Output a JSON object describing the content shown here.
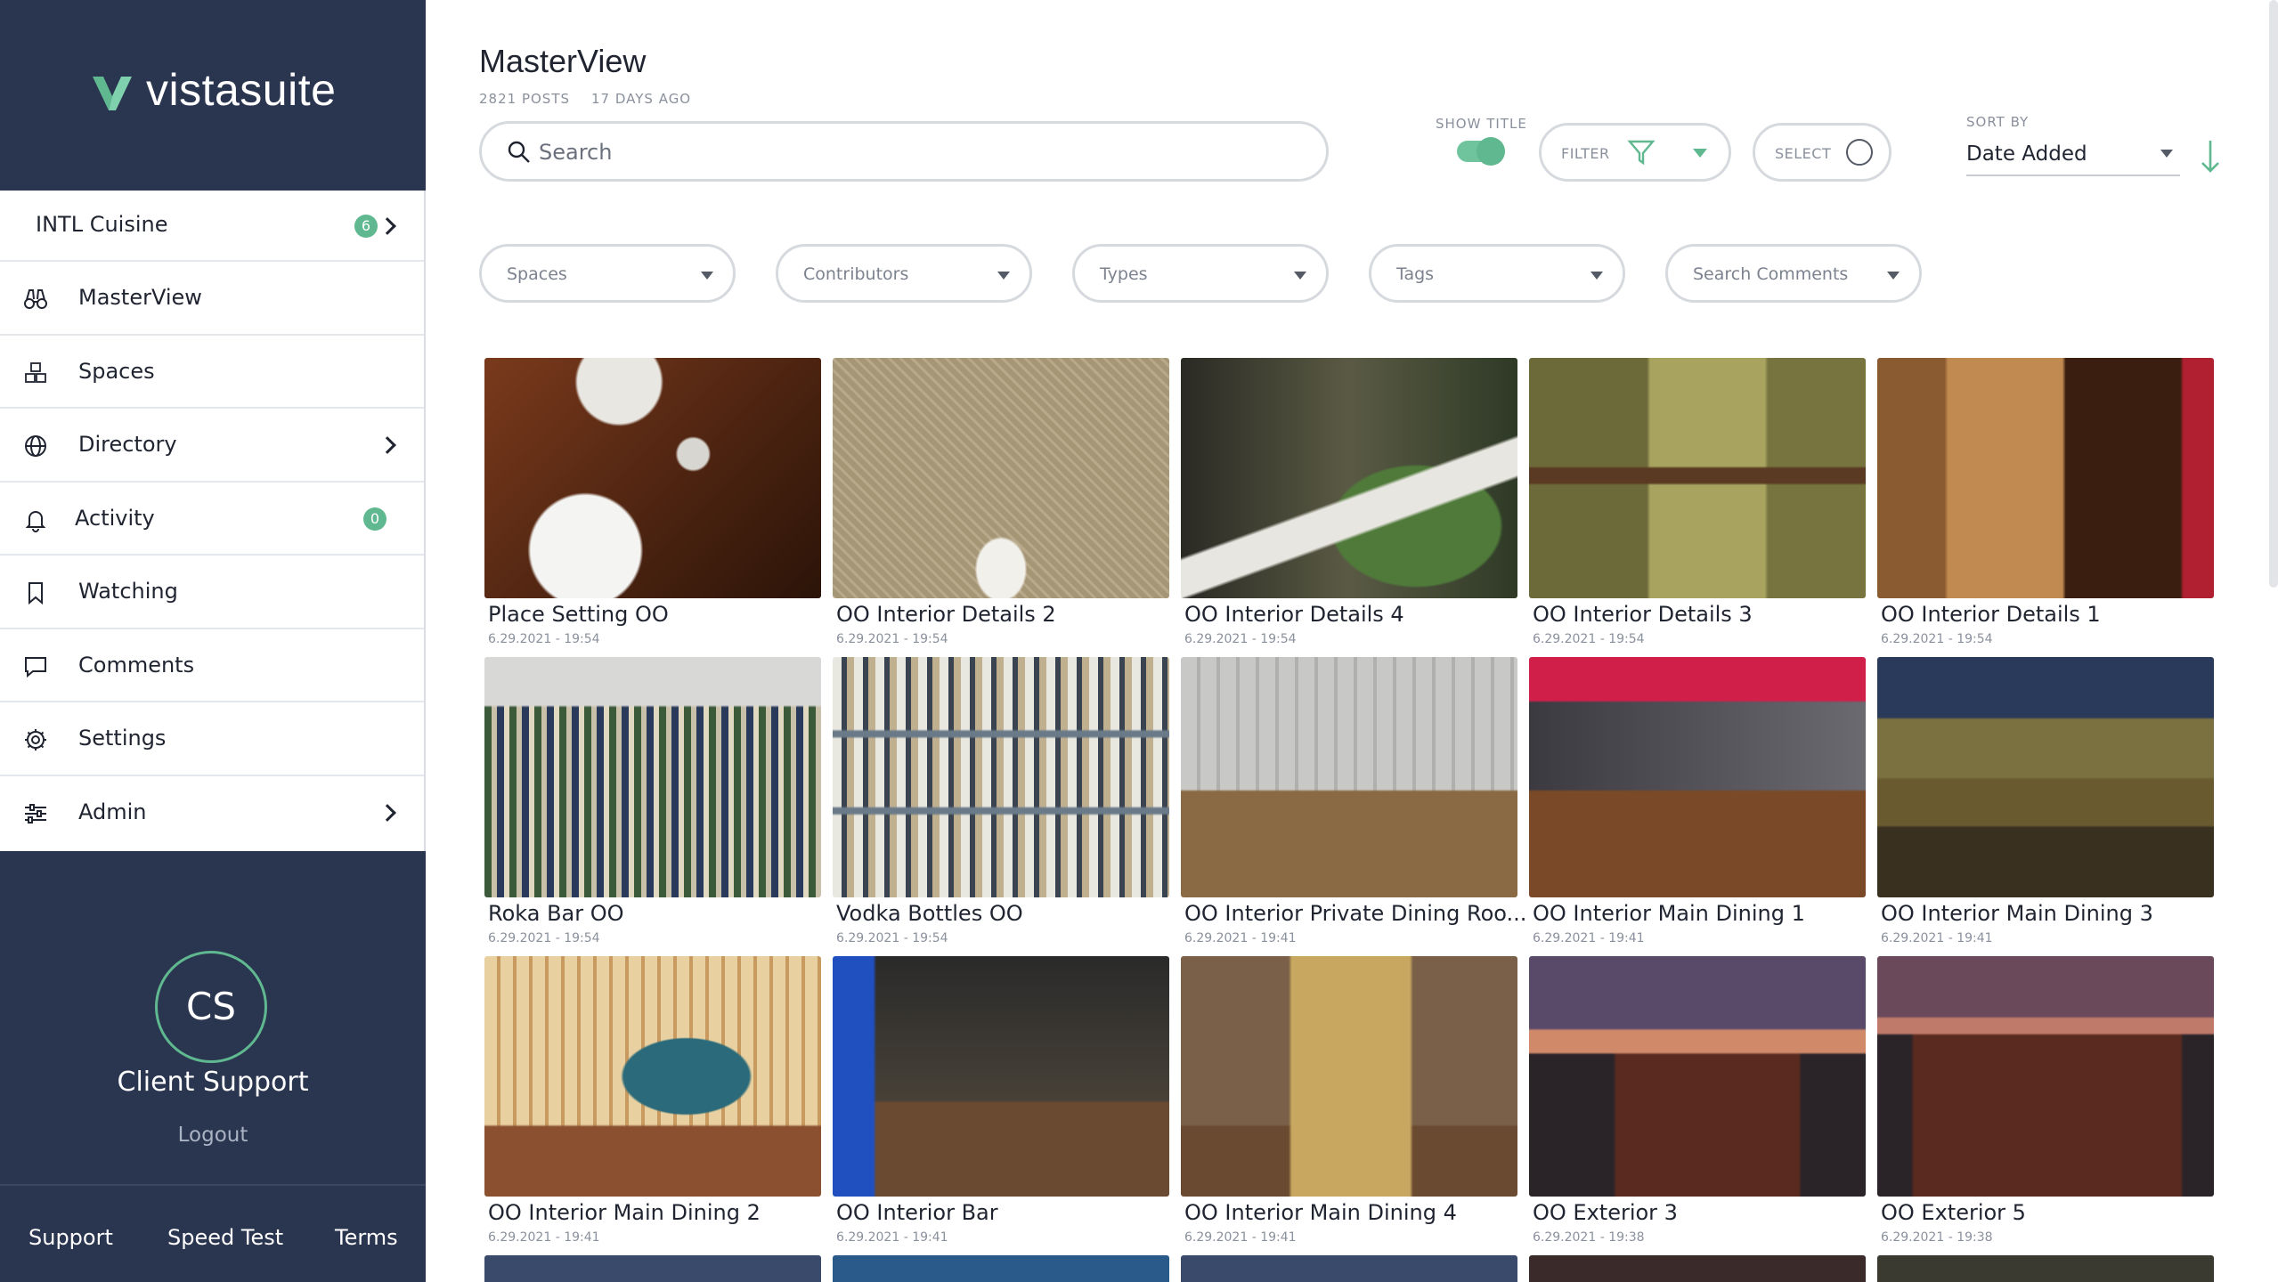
{
  "brand": {
    "name": "vistasuite"
  },
  "org": {
    "name": "INTL Cuisine",
    "badge": "6"
  },
  "nav": [
    {
      "label": "MasterView",
      "icon": "binoculars-icon"
    },
    {
      "label": "Spaces",
      "icon": "cubes-icon"
    },
    {
      "label": "Directory",
      "icon": "globe-icon"
    },
    {
      "label": "Activity",
      "icon": "bell-icon",
      "badge": "0"
    },
    {
      "label": "Watching",
      "icon": "bookmark-icon"
    },
    {
      "label": "Comments",
      "icon": "comment-icon"
    },
    {
      "label": "Settings",
      "icon": "gear-icon"
    },
    {
      "label": "Admin",
      "icon": "sliders-icon"
    }
  ],
  "user": {
    "initials": "CS",
    "name": "Client Support",
    "logout": "Logout"
  },
  "footer": {
    "support": "Support",
    "speed_test": "Speed Test",
    "terms": "Terms"
  },
  "header": {
    "title": "MasterView",
    "posts": "2821 POSTS",
    "updated": "17 DAYS AGO",
    "search_placeholder": "Search",
    "show_title_label": "SHOW TITLE",
    "filter_label": "FILTER",
    "select_label": "SELECT",
    "sort_by_label": "SORT BY",
    "sort_value": "Date Added"
  },
  "filters": [
    "Spaces",
    "Contributors",
    "Types",
    "Tags",
    "Search Comments"
  ],
  "colors": {
    "sidebar": "#2a3550",
    "accent": "#5fb88f"
  },
  "posts": [
    {
      "title": "Place Setting OO",
      "date": "6.29.2021 - 19:54"
    },
    {
      "title": "OO Interior Details 2",
      "date": "6.29.2021 - 19:54"
    },
    {
      "title": "OO Interior Details 4",
      "date": "6.29.2021 - 19:54"
    },
    {
      "title": "OO Interior Details 3",
      "date": "6.29.2021 - 19:54"
    },
    {
      "title": "OO Interior Details 1",
      "date": "6.29.2021 - 19:54"
    },
    {
      "title": "Roka Bar OO",
      "date": "6.29.2021 - 19:54"
    },
    {
      "title": "Vodka Bottles OO",
      "date": "6.29.2021 - 19:54"
    },
    {
      "title": "OO Interior Private Dining Roo...",
      "date": "6.29.2021 - 19:41"
    },
    {
      "title": "OO Interior Main Dining 1",
      "date": "6.29.2021 - 19:41"
    },
    {
      "title": "OO Interior Main Dining 3",
      "date": "6.29.2021 - 19:41"
    },
    {
      "title": "OO Interior Main Dining 2",
      "date": "6.29.2021 - 19:41"
    },
    {
      "title": "OO Interior Bar",
      "date": "6.29.2021 - 19:41"
    },
    {
      "title": "OO Interior Main Dining 4",
      "date": "6.29.2021 - 19:41"
    },
    {
      "title": "OO Exterior 3",
      "date": "6.29.2021 - 19:38"
    },
    {
      "title": "OO Exterior 5",
      "date": "6.29.2021 - 19:38"
    }
  ]
}
